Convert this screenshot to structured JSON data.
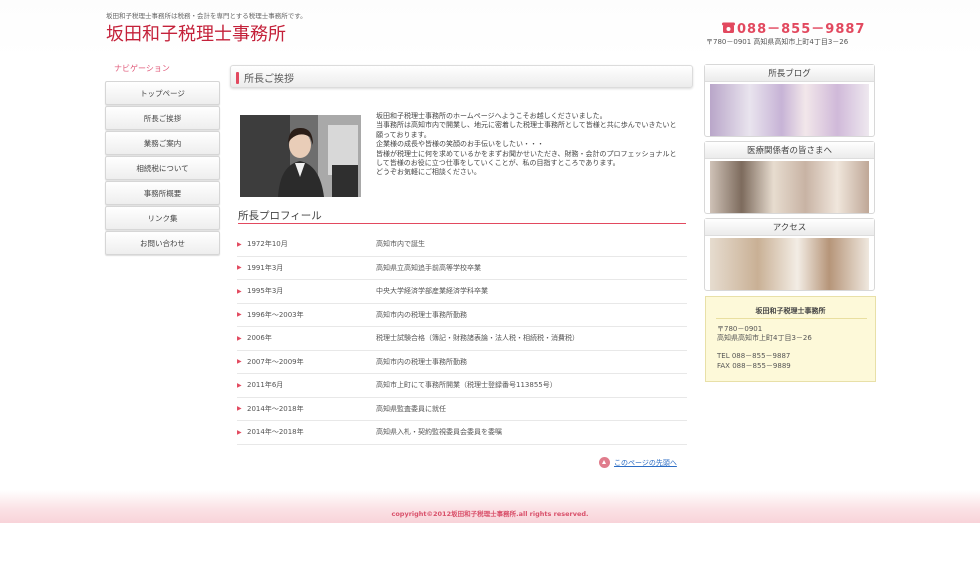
{
  "header": {
    "tagline": "坂田和子税理士事務所は税務・会計を専門とする税理士事務所です。",
    "site_title": "坂田和子税理士事務所",
    "phone": "088－855－9887",
    "address": "〒780－0901 高知県高知市上町4丁目3－26"
  },
  "nav": {
    "heading": "ナビゲーション",
    "items": [
      {
        "label": "トップページ"
      },
      {
        "label": "所長ご挨拶"
      },
      {
        "label": "業務ご案内"
      },
      {
        "label": "相続税について"
      },
      {
        "label": "事務所概要"
      },
      {
        "label": "リンク集"
      },
      {
        "label": "お問い合わせ"
      }
    ]
  },
  "main": {
    "section_title": "所長ご挨拶",
    "greeting": "坂田和子税理士事務所のホームページへようこそお越しくださいました。\n当事務所は高知市内で開業し、地元に密着した税理士事務所として皆様と共に歩んでいきたいと願っております。\n企業様の成長や皆様の笑顔のお手伝いをしたい・・・\n皆様が税理士に何を求めているかをまずお聞かせいただき、財務・会計のプロフェッショナルとして皆様のお役に立つ仕事をしていくことが、私の目指すところであります。\nどうぞお気軽にご相談ください。",
    "profile_title": "所長プロフィール",
    "profile": [
      {
        "year": "1972年10月",
        "desc": "高知市内で誕生"
      },
      {
        "year": "1991年3月",
        "desc": "高知県立高知追手前高等学校卒業"
      },
      {
        "year": "1995年3月",
        "desc": "中央大学経済学部産業経済学科卒業"
      },
      {
        "year": "1996年～2003年",
        "desc": "高知市内の税理士事務所勤務"
      },
      {
        "year": "2006年",
        "desc": "税理士試験合格（簿記・財務諸表論・法人税・相続税・消費税）"
      },
      {
        "year": "2007年～2009年",
        "desc": "高知市内の税理士事務所勤務"
      },
      {
        "year": "2011年6月",
        "desc": "高知市上町にて事務所開業（税理士登録番号113855号）"
      },
      {
        "year": "2014年～2018年",
        "desc": "高知県監査委員に就任"
      },
      {
        "year": "2014年～2018年",
        "desc": "高知県入札・契約監視委員会委員を委嘱"
      }
    ],
    "to_top": "このページの先頭へ"
  },
  "sidebar": {
    "blog_label": "所長ブログ",
    "medical_label": "医療関係者の皆さまへ",
    "access_label": "アクセス",
    "office": {
      "name": "坂田和子税理士事務所",
      "postal": "〒780－0901",
      "address": "高知県高知市上町4丁目3－26",
      "tel": "TEL 088－855－9887",
      "fax": "FAX 088－855－9889"
    }
  },
  "footer": {
    "copyright": "copyright©2012坂田和子税理士事務所.all rights reserved."
  },
  "colors": {
    "accent": "#c4213a",
    "pink": "#e2495f",
    "link": "#2b6cc4",
    "office_box_bg": "#fdf9d9"
  }
}
